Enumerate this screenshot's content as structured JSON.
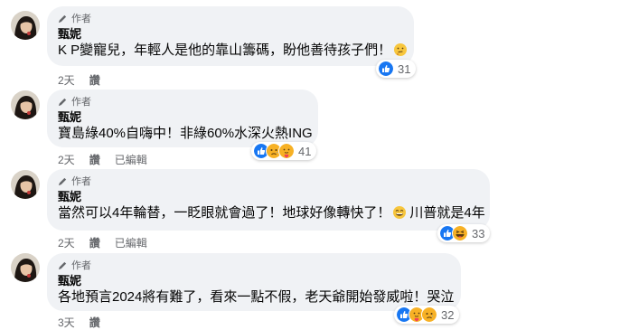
{
  "author_badge": "作者",
  "comments": [
    {
      "name": "甄妮",
      "text": "K P變寵兒，年輕人是他的靠山籌碼，盼他善待孩子們！",
      "trailing_emoji": "thinking-face",
      "reaction_count": "31",
      "reactions": [
        "like"
      ],
      "time": "2天",
      "reply": "讚",
      "edited": ""
    },
    {
      "name": "甄妮",
      "text": "寶島綠40%自嗨中！非綠60%水深火熱ING",
      "reaction_count": "41",
      "reactions": [
        "like",
        "sad",
        "care"
      ],
      "time": "2天",
      "reply": "讚",
      "edited": "已編輯"
    },
    {
      "name": "甄妮",
      "text_before": "當然可以4年輪替，一眨眼就會過了！地球好像轉快了！",
      "text_after": "川普就是4年",
      "inline_emoji": "grinning-face",
      "reaction_count": "33",
      "reactions": [
        "like",
        "haha"
      ],
      "time": "2天",
      "reply": "讚",
      "edited": "已編輯"
    },
    {
      "name": "甄妮",
      "text": "各地預言2024將有難了，看來一點不假，老天爺開始發威啦！哭泣",
      "reaction_count": "32",
      "reactions": [
        "like",
        "care",
        "sad"
      ],
      "time": "3天",
      "reply": "讚",
      "edited": ""
    }
  ],
  "colors": {
    "bubble": "#f0f2f5",
    "like_blue": "#1877f2",
    "meta_gray": "#65676b",
    "emoji_yellow": "#f7b125"
  }
}
